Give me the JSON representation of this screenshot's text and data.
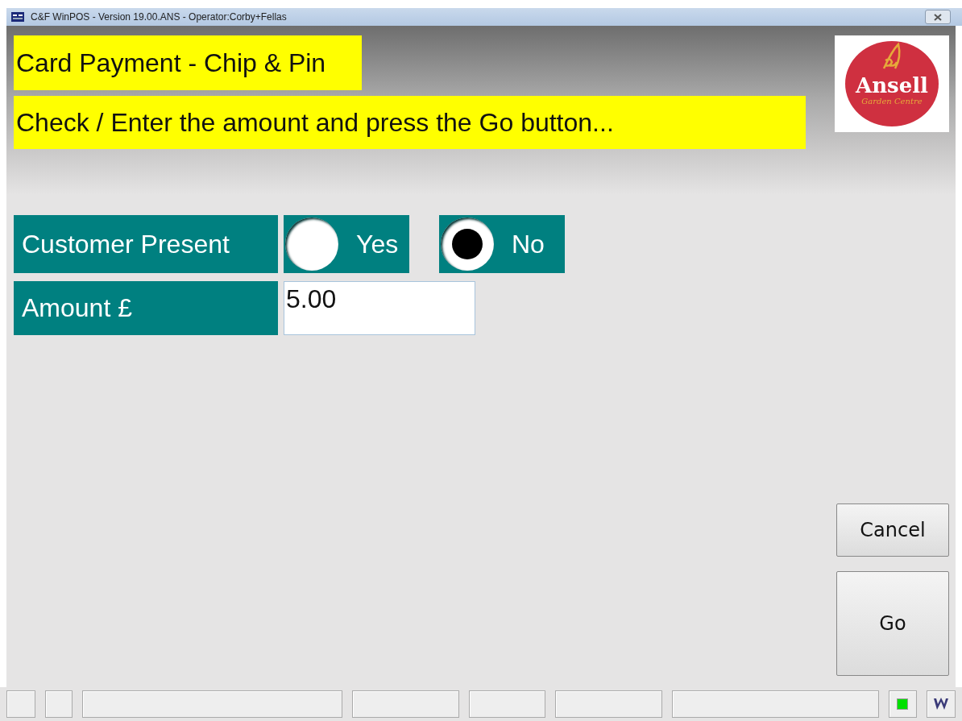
{
  "window": {
    "title": "C&F WinPOS - Version 19.00.ANS - Operator:Corby+Fellas"
  },
  "heading": "Card Payment - Chip & Pin",
  "instruction": "Check / Enter the amount and press the Go button...",
  "logo": {
    "name": "Ansell",
    "tagline": "Garden Centre"
  },
  "customer_present": {
    "label": "Customer Present",
    "options": [
      {
        "label": "Yes",
        "selected": false
      },
      {
        "label": "No",
        "selected": true
      }
    ]
  },
  "amount": {
    "label": "Amount £",
    "value": "5.00"
  },
  "buttons": [
    {
      "label": "Cancel",
      "kind": "small"
    },
    {
      "label": "Go",
      "kind": "large"
    }
  ],
  "status_bar": {
    "panels": [
      {
        "kind": "empty"
      },
      {
        "kind": "empty"
      },
      {
        "kind": "empty"
      },
      {
        "kind": "empty"
      },
      {
        "kind": "empty"
      },
      {
        "kind": "empty"
      },
      {
        "kind": "empty"
      },
      {
        "kind": "indicator",
        "on": true
      },
      {
        "kind": "logo"
      }
    ]
  }
}
